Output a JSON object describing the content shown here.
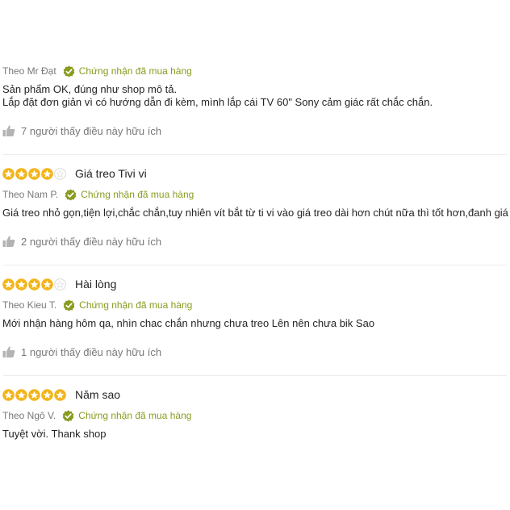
{
  "colors": {
    "star": "#f3b51d",
    "verified": "#8a9b1f",
    "muted": "#787878",
    "text": "#242424",
    "thumb": "#b3b3b3"
  },
  "reviews": [
    {
      "rating": null,
      "title": "",
      "author": "Theo Mr Đạt",
      "verified": "Chứng nhận đã mua hàng",
      "body": [
        "Sản phẩm OK, đúng như shop mô tả.",
        "Lắp đặt đơn giản vì có hướng dẫn đi kèm, mình lắp cái TV 60\" Sony cảm giác rất chắc chắn."
      ],
      "helpful": "7 người thấy điều này hữu ích"
    },
    {
      "rating": 4,
      "title": "Giá treo Tivi vi",
      "author": "Theo Nam P.",
      "verified": "Chứng nhận đã mua hàng",
      "body": [
        "Giá treo nhỏ gọn,tiện lợi,chắc chắn,tuy nhiên vít bắt từ ti vi vào giá treo dài hơn chút nữa thì tốt hơn,đanh giá"
      ],
      "helpful": "2 người thấy điều này hữu ích"
    },
    {
      "rating": 4,
      "title": "Hài lòng",
      "author": "Theo Kieu T.",
      "verified": "Chứng nhận đã mua hàng",
      "body": [
        "Mới nhận hàng hôm qa, nhìn chac chắn nhưng chưa treo Lên nên chưa bik Sao"
      ],
      "helpful": "1 người thấy điều này hữu ích"
    },
    {
      "rating": 5,
      "title": "Năm sao",
      "author": "Theo Ngô V.",
      "verified": "Chứng nhận đã mua hàng",
      "body": [
        "Tuyệt vời. Thank shop"
      ],
      "helpful": ""
    }
  ]
}
